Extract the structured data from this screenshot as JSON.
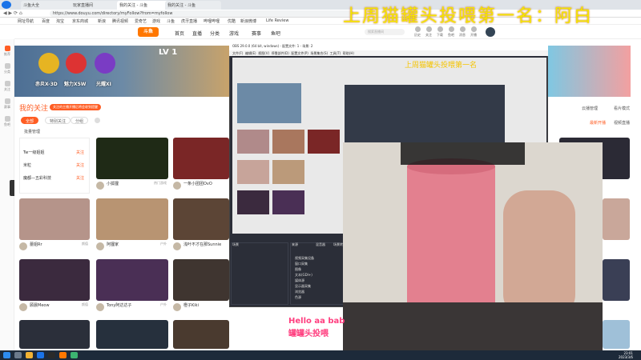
{
  "browser": {
    "tabs": [
      {
        "label": "斗鱼大全",
        "active": false
      },
      {
        "label": "玩家直播间",
        "active": false
      },
      {
        "label": "我的关注 - 斗鱼",
        "active": true
      },
      {
        "label": "我的关注 - 斗鱼",
        "active": false
      }
    ],
    "url": "https://www.douyu.com/directory/myFollow?from=myfollow",
    "bookmarks": [
      "网址导航",
      "百度",
      "淘宝",
      "京东商城",
      "新浪",
      "腾讯视频",
      "爱奇艺",
      "游戏",
      "斗鱼",
      "虎牙直播",
      "哔哩哔哩",
      "优酷",
      "新浪微博",
      "Life Review"
    ]
  },
  "site": {
    "logo": "斗鱼",
    "nav": [
      "首页",
      "直播",
      "分类",
      "游戏",
      "赛事",
      "鱼吧"
    ],
    "search_placeholder": "搜索直播间",
    "header_icons": [
      "历史",
      "关注",
      "下载",
      "鱼吧",
      "消息",
      "开播"
    ],
    "sidebar": [
      "推荐",
      "分类",
      "关注",
      "赛事",
      "鱼吧"
    ]
  },
  "banner": {
    "level": "LV 1",
    "badges": [
      "赤炎X-3D",
      "魅力X5W",
      "光耀XI"
    ]
  },
  "follow": {
    "title": "我的关注",
    "tip": "关注的主播开播后将会收到提醒",
    "tabs": [
      "全部",
      "特别关注",
      "分组"
    ],
    "manage": "批量管理",
    "online_panel": [
      {
        "name": "Tw一级姐姐",
        "action": "关注"
      },
      {
        "name": "米粒",
        "action": "关注"
      },
      {
        "name": "魔都—五彩科技",
        "action": "关注"
      }
    ]
  },
  "cards": [
    {
      "name": "小狐狸",
      "category": "热门游戏"
    },
    {
      "name": "一条小团团OvO",
      "category": "王者荣耀"
    },
    {
      "name": "蕾姐Rr",
      "category": "颜值"
    },
    {
      "name": "阿狸家",
      "category": "户外"
    },
    {
      "name": "浅叶不才在那Sunnie",
      "category": "英雄联盟"
    },
    {
      "name": "顾晨Meow",
      "category": "颜值"
    },
    {
      "name": "Tony阿达达子",
      "category": "户外"
    },
    {
      "name": "橙子Kiki",
      "category": "颜值"
    }
  ],
  "right_links": [
    "云播管理",
    "看片模式",
    "最新开播",
    "视频直播"
  ],
  "obs": {
    "title": "OBS 29.0.0 (64 bit, windows) - 配置文件: 1 - 场景: 2",
    "menu": [
      "文件(F)",
      "编辑(E)",
      "视图(V)",
      "停靠部件(D)",
      "配置文件(P)",
      "场景集合(S)",
      "工具(T)",
      "帮助(H)"
    ],
    "docks": [
      "场景",
      "来源",
      "混音器",
      "场景转换",
      "控件"
    ],
    "sources": [
      "视频采集设备",
      "窗口采集",
      "图像",
      "文本(GDI+)",
      "媒体源",
      "显示器采集",
      "浏览器",
      "色源"
    ]
  },
  "overlay": {
    "title": "上周猫罐头投喂第一名：阿白",
    "subtitle": "上周猫罐头投喂第一名",
    "pink_1": "Hello aa bab",
    "pink_2": "罐罐头投喂"
  },
  "taskbar": {
    "time": "23:01",
    "date": "2023/3/6"
  }
}
